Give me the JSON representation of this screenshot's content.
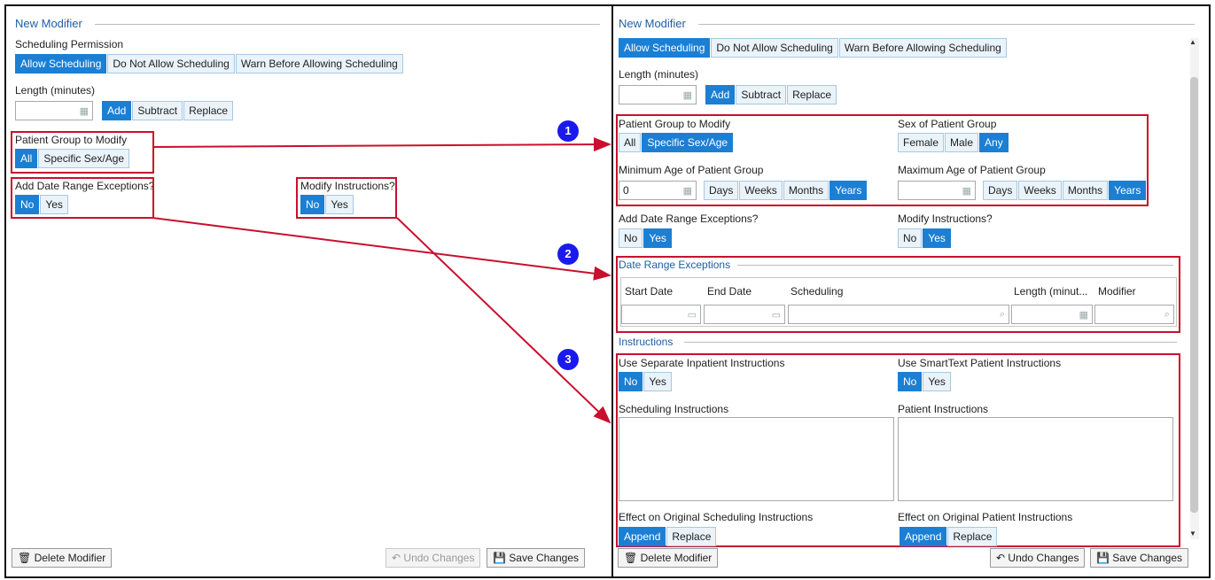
{
  "left": {
    "title": "New Modifier",
    "scheduling_permission_label": "Scheduling Permission",
    "scheduling_options": [
      "Allow Scheduling",
      "Do Not Allow Scheduling",
      "Warn Before Allowing Scheduling"
    ],
    "length_label": "Length (minutes)",
    "length_value": "",
    "length_ops": [
      "Add",
      "Subtract",
      "Replace"
    ],
    "patient_group_label": "Patient Group to Modify",
    "patient_group_options": [
      "All",
      "Specific Sex/Age"
    ],
    "date_range_label": "Add Date Range Exceptions?",
    "date_range_options": [
      "No",
      "Yes"
    ],
    "modify_instr_label": "Modify Instructions?",
    "modify_instr_options": [
      "No",
      "Yes"
    ],
    "delete_label": "Delete Modifier",
    "undo_label": "Undo Changes",
    "save_label": "Save Changes"
  },
  "badges": [
    "1",
    "2",
    "3"
  ],
  "right": {
    "title": "New Modifier",
    "scheduling_options": [
      "Allow Scheduling",
      "Do Not Allow Scheduling",
      "Warn Before Allowing Scheduling"
    ],
    "length_label": "Length (minutes)",
    "length_value": "",
    "length_ops": [
      "Add",
      "Subtract",
      "Replace"
    ],
    "patient_group_label": "Patient Group to Modify",
    "patient_group_options": [
      "All",
      "Specific Sex/Age"
    ],
    "sex_label": "Sex of Patient Group",
    "sex_options": [
      "Female",
      "Male",
      "Any"
    ],
    "min_age_label": "Minimum Age of Patient Group",
    "min_age_value": "0",
    "max_age_label": "Maximum Age of Patient Group",
    "max_age_value": "",
    "age_units": [
      "Days",
      "Weeks",
      "Months",
      "Years"
    ],
    "date_range_label": "Add Date Range Exceptions?",
    "date_range_options": [
      "No",
      "Yes"
    ],
    "modify_instr_label": "Modify Instructions?",
    "modify_instr_options": [
      "No",
      "Yes"
    ],
    "dre_section_title": "Date Range Exceptions",
    "dre_columns": [
      "Start Date",
      "End Date",
      "Scheduling",
      "Length (minut...",
      "Modifier"
    ],
    "instructions_title": "Instructions",
    "sep_inpatient_label": "Use Separate Inpatient Instructions",
    "sep_inpatient_options": [
      "No",
      "Yes"
    ],
    "smarttext_label": "Use SmartText Patient Instructions",
    "smarttext_options": [
      "No",
      "Yes"
    ],
    "sched_instr_label": "Scheduling Instructions",
    "patient_instr_label": "Patient Instructions",
    "effect_sched_label": "Effect on Original Scheduling Instructions",
    "effect_sched_options": [
      "Append",
      "Replace"
    ],
    "effect_patient_label": "Effect on Original Patient Instructions",
    "effect_patient_options": [
      "Append",
      "Replace"
    ],
    "delete_label": "Delete Modifier",
    "undo_label": "Undo Changes",
    "save_label": "Save Changes"
  },
  "colors": {
    "accent": "#1b7fd4",
    "annotation_red": "#c8102e",
    "badge_blue": "#1a1aee",
    "title_blue": "#1f5fa6"
  },
  "icons": [
    "calculator-icon",
    "calendar-icon",
    "search-icon",
    "trash-icon",
    "undo-icon",
    "save-icon",
    "scroll-up-icon",
    "scroll-down-icon"
  ]
}
